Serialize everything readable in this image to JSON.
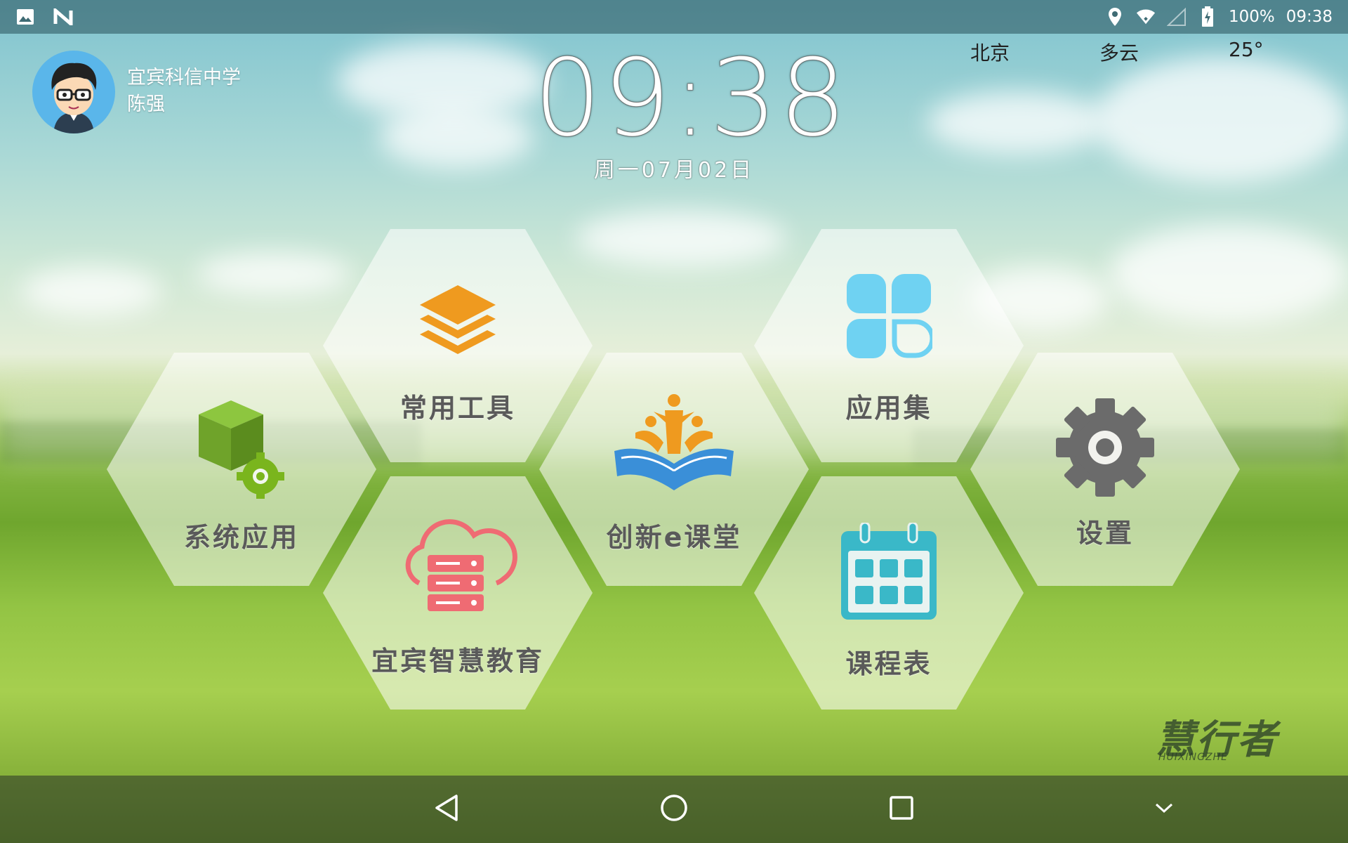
{
  "status_bar": {
    "left_icons": [
      "image-icon",
      "n-icon"
    ],
    "right_icons": [
      "location-icon",
      "wifi-icon",
      "signal-icon",
      "battery-icon"
    ],
    "battery": "100%",
    "time": "09:38"
  },
  "profile": {
    "school": "宜宾科信中学",
    "name": "陈强"
  },
  "clock": {
    "time": "09:38",
    "date": "周一07月02日"
  },
  "weather": {
    "city": "北京",
    "condition": "多云",
    "temperature": "25°"
  },
  "apps": [
    {
      "label": "常用工具",
      "icon": "layers-icon",
      "color": "#ef9a1f"
    },
    {
      "label": "应用集",
      "icon": "clover-icon",
      "color": "#6fd2f2"
    },
    {
      "label": "系统应用",
      "icon": "cube-gear-icon",
      "color": "#7ab51d"
    },
    {
      "label": "创新e课堂",
      "icon": "book-people-icon",
      "color": "#3a8fd8"
    },
    {
      "label": "设置",
      "icon": "gear-icon",
      "color": "#6b6b6b"
    },
    {
      "label": "宜宾智慧教育",
      "icon": "cloud-server-icon",
      "color": "#ef6b73"
    },
    {
      "label": "课程表",
      "icon": "calendar-icon",
      "color": "#3ab8c8"
    }
  ],
  "brand": {
    "cn": "慧行者",
    "en": "HUIXINGZHE"
  },
  "nav_bar": {
    "buttons": [
      "back-icon",
      "home-icon",
      "recents-icon",
      "chevron-down-icon"
    ]
  }
}
